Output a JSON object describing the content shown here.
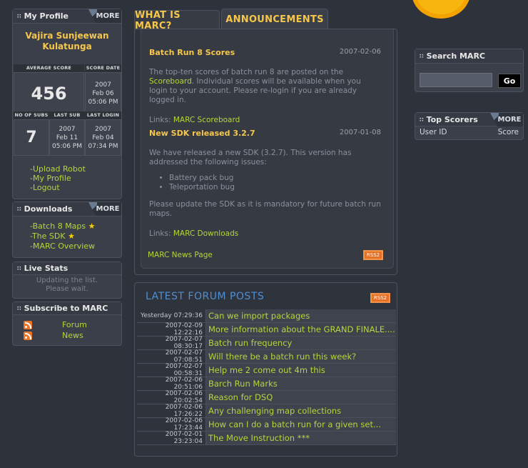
{
  "profile": {
    "title": "My Profile",
    "more": "MORE",
    "name": "Vajira Sunjeewan Kulatunga",
    "avg_score_label": "AVERAGE SCORE",
    "avg_score": "456",
    "score_date_label": "SCORE DATE",
    "score_date": [
      "2007",
      "Feb 06",
      "05:06 PM"
    ],
    "subs_label": "NO OF SUBS",
    "subs": "7",
    "last_sub_label": "LAST SUB",
    "last_sub": [
      "2007",
      "Feb 11",
      "05:06 PM"
    ],
    "last_login_label": "LAST LOGIN",
    "last_login": [
      "2007",
      "Feb 04",
      "07:34 PM"
    ],
    "links": [
      "-Upload Robot",
      "-My Profile",
      "-Logout"
    ]
  },
  "downloads": {
    "title": "Downloads",
    "more": "MORE",
    "links": [
      "-Batch 8 Maps",
      "-The SDK",
      "-MARC Overview"
    ]
  },
  "live_stats": {
    "title": "Live Stats",
    "text": [
      "Updating the list.",
      "Please wait."
    ]
  },
  "subscribe": {
    "title": "Subscribe to MARC",
    "links": [
      "Forum",
      "News"
    ]
  },
  "tabs": [
    "WHAT IS MARC?",
    "ANNOUNCEMENTS"
  ],
  "news": [
    {
      "title": "Batch Run 8 Scores",
      "date": "2007-02-06",
      "p1": "The top-ten scores of batch run 8 are posted on the ",
      "p1_link": "Scoreboard",
      "p1_end": ". Individual scores will be available when you login to your account. Please re-login if you are already logged in.",
      "links_label": "Links: ",
      "link": "MARC Scoreboard"
    },
    {
      "title": "New SDK released 3.2.7",
      "date": "2007-01-08",
      "p1": "We have released a new SDK (3.2.7). This version has addressed the following issues:",
      "bullets": [
        "Battery pack bug",
        "Teleportation bug"
      ],
      "p2": "Please update the SDK as it is mandatory for future batch run maps.",
      "links_label": "Links: ",
      "link": "MARC Downloads"
    }
  ],
  "news_page": "MARC News Page",
  "rss": "RSS2",
  "forum": {
    "title": "LATEST FORUM POSTS",
    "posts": [
      {
        "ts": "Yesterday 07:29:36",
        "title": "Can we import packages"
      },
      {
        "ts": "2007-02-09 12:22:16",
        "title": "More information about the GRAND FINALE...."
      },
      {
        "ts": "2007-02-07 08:30:17",
        "title": "Batch run frequency"
      },
      {
        "ts": "2007-02-07 07:08:51",
        "title": "Will there be a batch run this week?"
      },
      {
        "ts": "2007-02-07 00:58:31",
        "title": "Help me 2 come out 4m this"
      },
      {
        "ts": "2007-02-06 20:51:06",
        "title": "Barch Run Marks"
      },
      {
        "ts": "2007-02-06 20:02:54",
        "title": "Reason for DSQ"
      },
      {
        "ts": "2007-02-06 17:26:22",
        "title": "Any challenging map collections"
      },
      {
        "ts": "2007-02-06 17:23:44",
        "title": "How can I do a batch run for a given set..."
      },
      {
        "ts": "2007-02-01 23:23:04",
        "title": "The Move Instruction ***"
      }
    ]
  },
  "search": {
    "title": "Search MARC",
    "go": "Go",
    "value": ""
  },
  "top_scorers": {
    "title": "Top Scorers",
    "more": "MORE",
    "col_user": "User ID",
    "col_score": "Score"
  },
  "colors": {
    "accent": "#f7c74a",
    "link": "#b6d53a",
    "forum_title": "#4f8fd6",
    "rss": "#e67026"
  }
}
